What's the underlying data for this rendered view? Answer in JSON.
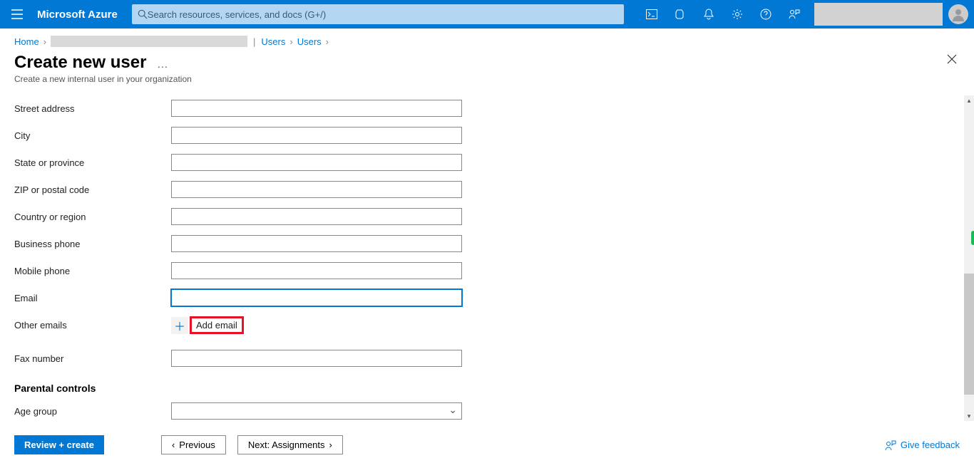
{
  "brand": "Microsoft Azure",
  "search": {
    "placeholder": "Search resources, services, and docs (G+/)"
  },
  "breadcrumb": {
    "home": "Home",
    "users1": "Users",
    "users2": "Users"
  },
  "header": {
    "title": "Create new user",
    "subtitle": "Create a new internal user in your organization",
    "more": "…"
  },
  "form": {
    "street_address": {
      "label": "Street address",
      "value": ""
    },
    "city": {
      "label": "City",
      "value": ""
    },
    "state": {
      "label": "State or province",
      "value": ""
    },
    "zip": {
      "label": "ZIP or postal code",
      "value": ""
    },
    "country": {
      "label": "Country or region",
      "value": ""
    },
    "business_phone": {
      "label": "Business phone",
      "value": ""
    },
    "mobile_phone": {
      "label": "Mobile phone",
      "value": ""
    },
    "email": {
      "label": "Email",
      "value": ""
    },
    "other_emails": {
      "label": "Other emails",
      "add_label": "Add email"
    },
    "fax": {
      "label": "Fax number",
      "value": ""
    },
    "parental_section": "Parental controls",
    "age_group": {
      "label": "Age group",
      "value": ""
    }
  },
  "footer": {
    "review": "Review + create",
    "previous": "Previous",
    "next": "Next: Assignments",
    "feedback": "Give feedback"
  }
}
